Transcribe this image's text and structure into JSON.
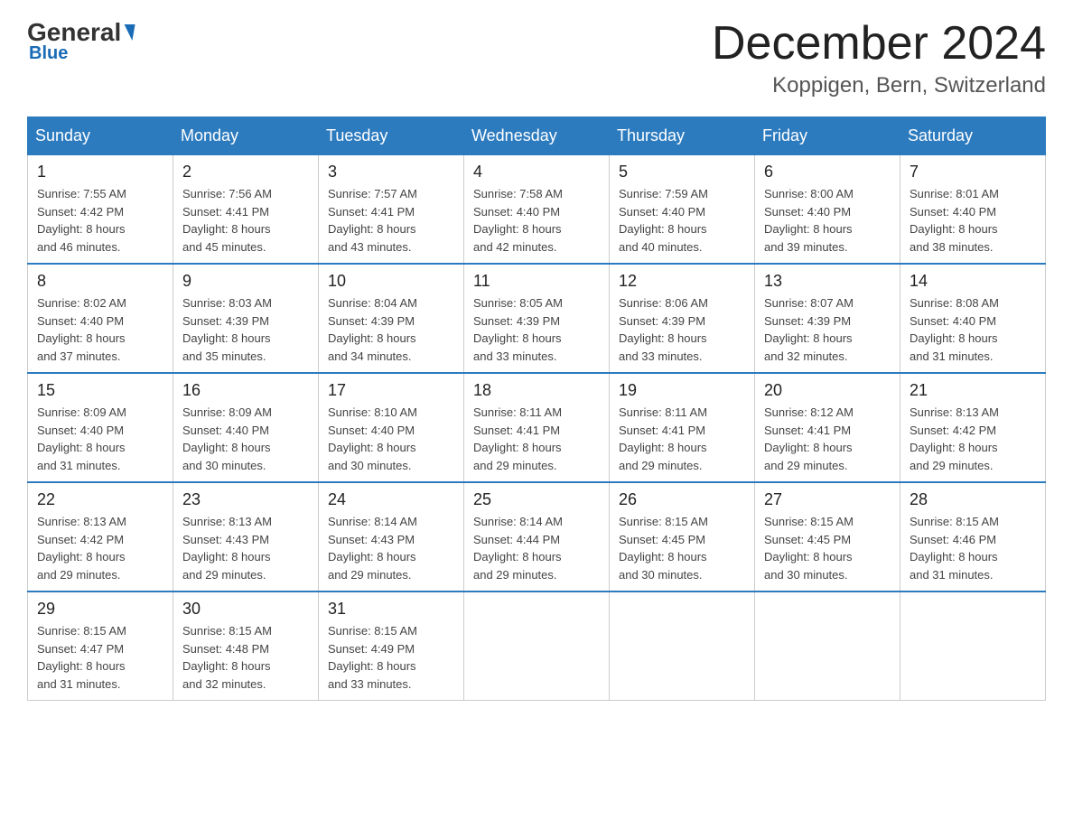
{
  "header": {
    "logo_general": "General",
    "logo_blue": "Blue",
    "month_title": "December 2024",
    "location": "Koppigen, Bern, Switzerland"
  },
  "days_of_week": [
    "Sunday",
    "Monday",
    "Tuesday",
    "Wednesday",
    "Thursday",
    "Friday",
    "Saturday"
  ],
  "weeks": [
    [
      {
        "day": "1",
        "sunrise": "7:55 AM",
        "sunset": "4:42 PM",
        "daylight": "8 hours and 46 minutes."
      },
      {
        "day": "2",
        "sunrise": "7:56 AM",
        "sunset": "4:41 PM",
        "daylight": "8 hours and 45 minutes."
      },
      {
        "day": "3",
        "sunrise": "7:57 AM",
        "sunset": "4:41 PM",
        "daylight": "8 hours and 43 minutes."
      },
      {
        "day": "4",
        "sunrise": "7:58 AM",
        "sunset": "4:40 PM",
        "daylight": "8 hours and 42 minutes."
      },
      {
        "day": "5",
        "sunrise": "7:59 AM",
        "sunset": "4:40 PM",
        "daylight": "8 hours and 40 minutes."
      },
      {
        "day": "6",
        "sunrise": "8:00 AM",
        "sunset": "4:40 PM",
        "daylight": "8 hours and 39 minutes."
      },
      {
        "day": "7",
        "sunrise": "8:01 AM",
        "sunset": "4:40 PM",
        "daylight": "8 hours and 38 minutes."
      }
    ],
    [
      {
        "day": "8",
        "sunrise": "8:02 AM",
        "sunset": "4:40 PM",
        "daylight": "8 hours and 37 minutes."
      },
      {
        "day": "9",
        "sunrise": "8:03 AM",
        "sunset": "4:39 PM",
        "daylight": "8 hours and 35 minutes."
      },
      {
        "day": "10",
        "sunrise": "8:04 AM",
        "sunset": "4:39 PM",
        "daylight": "8 hours and 34 minutes."
      },
      {
        "day": "11",
        "sunrise": "8:05 AM",
        "sunset": "4:39 PM",
        "daylight": "8 hours and 33 minutes."
      },
      {
        "day": "12",
        "sunrise": "8:06 AM",
        "sunset": "4:39 PM",
        "daylight": "8 hours and 33 minutes."
      },
      {
        "day": "13",
        "sunrise": "8:07 AM",
        "sunset": "4:39 PM",
        "daylight": "8 hours and 32 minutes."
      },
      {
        "day": "14",
        "sunrise": "8:08 AM",
        "sunset": "4:40 PM",
        "daylight": "8 hours and 31 minutes."
      }
    ],
    [
      {
        "day": "15",
        "sunrise": "8:09 AM",
        "sunset": "4:40 PM",
        "daylight": "8 hours and 31 minutes."
      },
      {
        "day": "16",
        "sunrise": "8:09 AM",
        "sunset": "4:40 PM",
        "daylight": "8 hours and 30 minutes."
      },
      {
        "day": "17",
        "sunrise": "8:10 AM",
        "sunset": "4:40 PM",
        "daylight": "8 hours and 30 minutes."
      },
      {
        "day": "18",
        "sunrise": "8:11 AM",
        "sunset": "4:41 PM",
        "daylight": "8 hours and 29 minutes."
      },
      {
        "day": "19",
        "sunrise": "8:11 AM",
        "sunset": "4:41 PM",
        "daylight": "8 hours and 29 minutes."
      },
      {
        "day": "20",
        "sunrise": "8:12 AM",
        "sunset": "4:41 PM",
        "daylight": "8 hours and 29 minutes."
      },
      {
        "day": "21",
        "sunrise": "8:13 AM",
        "sunset": "4:42 PM",
        "daylight": "8 hours and 29 minutes."
      }
    ],
    [
      {
        "day": "22",
        "sunrise": "8:13 AM",
        "sunset": "4:42 PM",
        "daylight": "8 hours and 29 minutes."
      },
      {
        "day": "23",
        "sunrise": "8:13 AM",
        "sunset": "4:43 PM",
        "daylight": "8 hours and 29 minutes."
      },
      {
        "day": "24",
        "sunrise": "8:14 AM",
        "sunset": "4:43 PM",
        "daylight": "8 hours and 29 minutes."
      },
      {
        "day": "25",
        "sunrise": "8:14 AM",
        "sunset": "4:44 PM",
        "daylight": "8 hours and 29 minutes."
      },
      {
        "day": "26",
        "sunrise": "8:15 AM",
        "sunset": "4:45 PM",
        "daylight": "8 hours and 30 minutes."
      },
      {
        "day": "27",
        "sunrise": "8:15 AM",
        "sunset": "4:45 PM",
        "daylight": "8 hours and 30 minutes."
      },
      {
        "day": "28",
        "sunrise": "8:15 AM",
        "sunset": "4:46 PM",
        "daylight": "8 hours and 31 minutes."
      }
    ],
    [
      {
        "day": "29",
        "sunrise": "8:15 AM",
        "sunset": "4:47 PM",
        "daylight": "8 hours and 31 minutes."
      },
      {
        "day": "30",
        "sunrise": "8:15 AM",
        "sunset": "4:48 PM",
        "daylight": "8 hours and 32 minutes."
      },
      {
        "day": "31",
        "sunrise": "8:15 AM",
        "sunset": "4:49 PM",
        "daylight": "8 hours and 33 minutes."
      },
      null,
      null,
      null,
      null
    ]
  ],
  "labels": {
    "sunrise": "Sunrise:",
    "sunset": "Sunset:",
    "daylight": "Daylight:"
  }
}
